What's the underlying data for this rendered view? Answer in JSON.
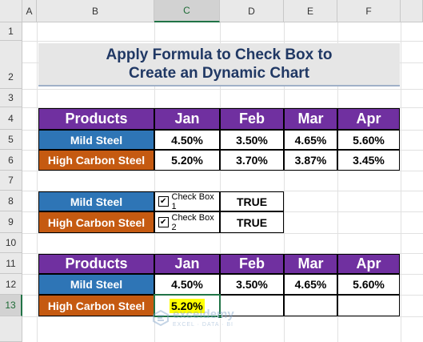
{
  "columns": [
    "A",
    "B",
    "C",
    "D",
    "E",
    "F"
  ],
  "rows": [
    "1",
    "2",
    "3",
    "4",
    "5",
    "6",
    "7",
    "8",
    "9",
    "10",
    "11",
    "12",
    "13"
  ],
  "title": {
    "line1": "Apply Formula to Check Box to",
    "line2": "Create an Dynamic Chart"
  },
  "table1": {
    "header": [
      "Products",
      "Jan",
      "Feb",
      "Mar",
      "Apr"
    ],
    "rows": [
      {
        "label": "Mild Steel",
        "values": [
          "4.50%",
          "3.50%",
          "4.65%",
          "5.60%"
        ]
      },
      {
        "label": "High Carbon Steel",
        "values": [
          "5.20%",
          "3.70%",
          "3.87%",
          "3.45%"
        ]
      }
    ]
  },
  "checkboxes": [
    {
      "label": "Mild Steel",
      "caption": "Check Box 1",
      "checked": true,
      "value": "TRUE"
    },
    {
      "label": "High Carbon Steel",
      "caption": "Check Box 2",
      "checked": true,
      "value": "TRUE"
    }
  ],
  "table2": {
    "header": [
      "Products",
      "Jan",
      "Feb",
      "Mar",
      "Apr"
    ],
    "rows": [
      {
        "label": "Mild Steel",
        "values": [
          "4.50%",
          "3.50%",
          "4.65%",
          "5.60%"
        ]
      },
      {
        "label": "High Carbon Steel",
        "values": [
          "5.20%",
          "",
          "",
          ""
        ]
      }
    ]
  },
  "colors": {
    "header_purple": "#7030a0",
    "mild_blue": "#2e75b6",
    "carbon_orange": "#c55a11",
    "highlight": "#ffff00",
    "title_text": "#203864"
  },
  "watermark": {
    "name": "exceldemy",
    "tagline": "EXCEL · DATA · BI"
  }
}
